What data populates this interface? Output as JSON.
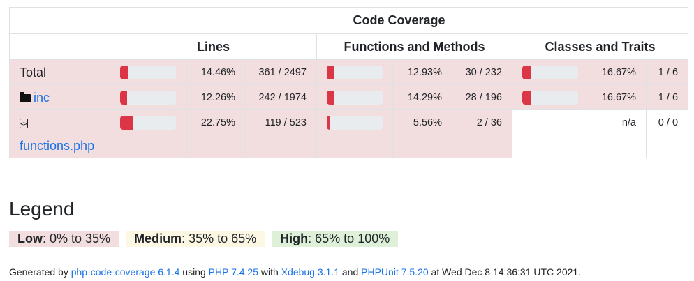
{
  "table": {
    "title": "Code Coverage",
    "groups": [
      "Lines",
      "Functions and Methods",
      "Classes and Traits"
    ],
    "rows": [
      {
        "name": "Total",
        "lines": {
          "percent": "14.46%",
          "ratio": "361 / 2497",
          "fill": 0.1446
        },
        "functions": {
          "percent": "12.93%",
          "ratio": "30 / 232",
          "fill": 0.1293
        },
        "classes": {
          "percent": "16.67%",
          "ratio": "1 / 6",
          "fill": 0.1667
        }
      },
      {
        "name": "inc",
        "icon": "folder-icon",
        "lines": {
          "percent": "12.26%",
          "ratio": "242 / 1974",
          "fill": 0.1226
        },
        "functions": {
          "percent": "14.29%",
          "ratio": "28 / 196",
          "fill": 0.1429
        },
        "classes": {
          "percent": "16.67%",
          "ratio": "1 / 6",
          "fill": 0.1667
        }
      },
      {
        "name": "functions.php",
        "icon": "code-file-icon",
        "lines": {
          "percent": "22.75%",
          "ratio": "119 / 523",
          "fill": 0.2275
        },
        "functions": {
          "percent": "5.56%",
          "ratio": "2 / 36",
          "fill": 0.0556
        },
        "classes": {
          "percent": "n/a",
          "ratio": "0 / 0"
        }
      }
    ]
  },
  "legend": {
    "title": "Legend",
    "low_label": "Low",
    "low_range": ": 0% to 35%",
    "medium_label": "Medium",
    "medium_range": ": 35% to 65%",
    "high_label": "High",
    "high_range": ": 65% to 100%"
  },
  "footer": {
    "generated_by": "Generated by ",
    "tool": "php-code-coverage 6.1.4",
    "using": " using ",
    "php": "PHP 7.4.25",
    "with": " with ",
    "xdebug": "Xdebug 3.1.1",
    "and": " and ",
    "phpunit": "PHPUnit 7.5.20",
    "date": " at Wed Dec 8 14:36:31 UTC 2021."
  },
  "colors": {
    "danger": "#dc3545",
    "low_bg": "#f2dede",
    "medium_bg": "#fcf8e3",
    "high_bg": "#dff0d8",
    "link": "#1a73e8"
  }
}
